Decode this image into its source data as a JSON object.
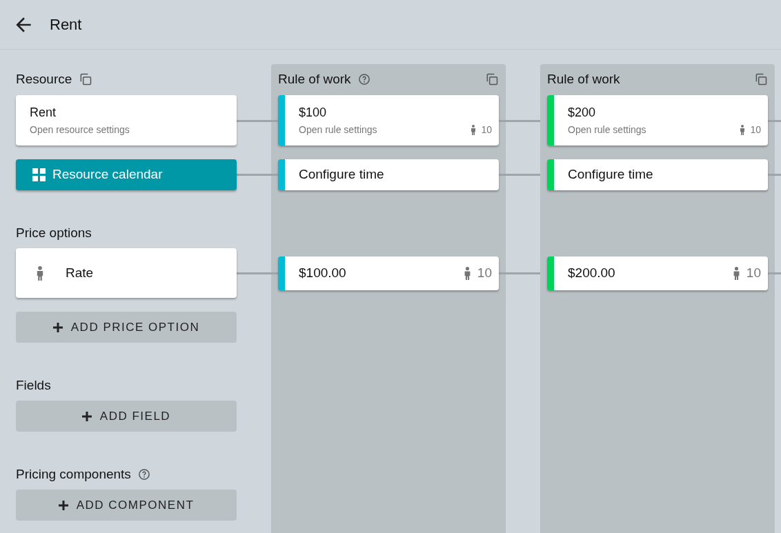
{
  "header": {
    "title": "Rent"
  },
  "resource": {
    "label": "Resource",
    "card": {
      "title": "Rent",
      "subtitle": "Open resource settings"
    },
    "calendar_button": "Resource calendar"
  },
  "price_options": {
    "label": "Price options",
    "items": [
      {
        "label": "Rate"
      }
    ],
    "add_button": "ADD PRICE OPTION"
  },
  "fields": {
    "label": "Fields",
    "add_button": "ADD FIELD"
  },
  "pricing_components": {
    "label": "Pricing components",
    "has_help": true,
    "add_button": "ADD COMPONENT"
  },
  "rules": [
    {
      "title": "Rule of work",
      "has_help": true,
      "color": "#00bcd4",
      "price": "$100",
      "subtitle": "Open rule settings",
      "capacity": "10",
      "time_button": "Configure time",
      "prices": [
        {
          "value": "$100.00",
          "capacity": "10"
        }
      ]
    },
    {
      "title": "Rule of work",
      "has_help": false,
      "color": "#00d35a",
      "price": "$200",
      "subtitle": "Open rule settings",
      "capacity": "10",
      "time_button": "Configure time",
      "prices": [
        {
          "value": "$200.00",
          "capacity": "10"
        }
      ]
    }
  ]
}
